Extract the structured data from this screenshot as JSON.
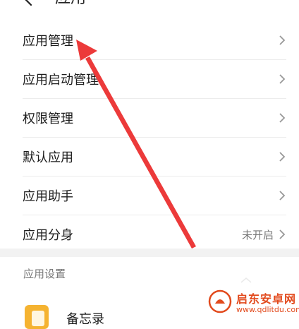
{
  "header": {
    "title": "应用"
  },
  "menu": {
    "items": [
      {
        "label": "应用管理",
        "value": ""
      },
      {
        "label": "应用启动管理",
        "value": ""
      },
      {
        "label": "权限管理",
        "value": ""
      },
      {
        "label": "默认应用",
        "value": ""
      },
      {
        "label": "应用助手",
        "value": ""
      },
      {
        "label": "应用分身",
        "value": "未开启"
      }
    ]
  },
  "section": {
    "title": "应用设置"
  },
  "apps": [
    {
      "label": "备忘录",
      "icon": "memo-icon"
    }
  ],
  "watermark": {
    "name": "启东安卓网",
    "url": "www.qdlitdu.com"
  },
  "colors": {
    "annotation_arrow": "#ec3a3a",
    "watermark": "#e24a1d"
  }
}
